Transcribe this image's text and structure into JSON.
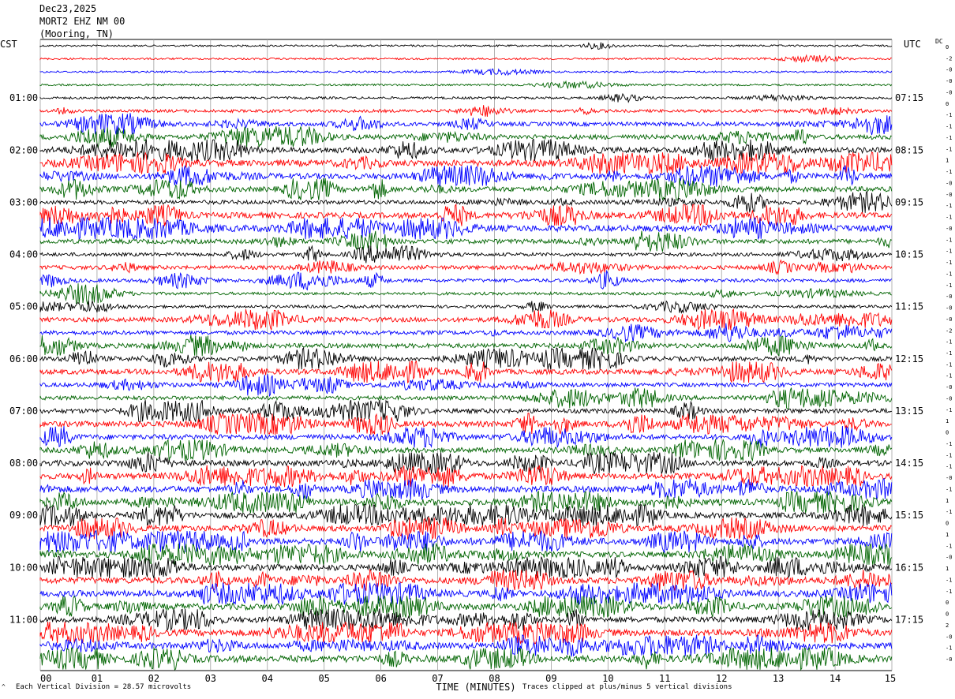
{
  "header": {
    "date": "Dec23,2025",
    "station": "MORT2 EHZ NM 00",
    "location": "(Mooring, TN)"
  },
  "left_axis_label": "CST",
  "right_axis_label": "UTC",
  "dc_label": "DC",
  "footer": {
    "scale_text": "Each Vertical Division =   28.57 microvolts",
    "clip_text": "Traces clipped at plus/minus 5 vertical divisions",
    "corner_mark": "^"
  },
  "colors": {
    "black": "#000000",
    "red": "#ff0000",
    "blue": "#0000ff",
    "green": "#006400",
    "grid": "#a0a0a0"
  },
  "chart_data": {
    "type": "line",
    "subtype": "helicorder",
    "xlabel": "TIME (MINUTES)",
    "x_ticks": [
      "00",
      "01",
      "02",
      "03",
      "04",
      "05",
      "06",
      "07",
      "08",
      "09",
      "10",
      "11",
      "12",
      "13",
      "14",
      "15"
    ],
    "xlim": [
      0,
      15
    ],
    "trace_count": 48,
    "color_cycle": [
      "black",
      "red",
      "blue",
      "green"
    ],
    "left_hour_labels": [
      "01:00",
      "02:00",
      "03:00",
      "04:00",
      "05:00",
      "06:00",
      "07:00",
      "08:00",
      "09:00",
      "10:00",
      "11:00"
    ],
    "right_hour_labels": [
      "07:15",
      "08:15",
      "09:15",
      "10:15",
      "11:15",
      "12:15",
      "13:15",
      "14:15",
      "15:15",
      "16:15",
      "17:15"
    ],
    "hour_label_trace_start": 4,
    "dc_offsets": [
      "0",
      "-2",
      "-0",
      "-0",
      "-0",
      "0",
      "-1",
      "-1",
      "-1",
      "-1",
      "1",
      "-1",
      "-0",
      "-0",
      "-1",
      "-1",
      "-0",
      "-1",
      "-1",
      "-1",
      "-1",
      "-1",
      "-0",
      "-0",
      "-0",
      "-2",
      "-1",
      "-1",
      "-1",
      "-1",
      "-0",
      "-0",
      "-1",
      "1",
      "0",
      "-1",
      "-1",
      "-1",
      "-0",
      "-1",
      "1",
      "-1",
      "0",
      "1",
      "-1",
      "-0",
      "1",
      "-1",
      "-1",
      "0",
      "0",
      "2",
      "-0",
      "-1",
      "-0"
    ],
    "activity_level": [
      1,
      1,
      1,
      1,
      2,
      3,
      5,
      6,
      8,
      9,
      8,
      7,
      5,
      8,
      9,
      6,
      4,
      5,
      4,
      3,
      3,
      6,
      5,
      6,
      6,
      7,
      5,
      5,
      6,
      8,
      7,
      7,
      8,
      8,
      9,
      9,
      8,
      8,
      9,
      8,
      9,
      9,
      9,
      9,
      8,
      9,
      9,
      10
    ]
  }
}
